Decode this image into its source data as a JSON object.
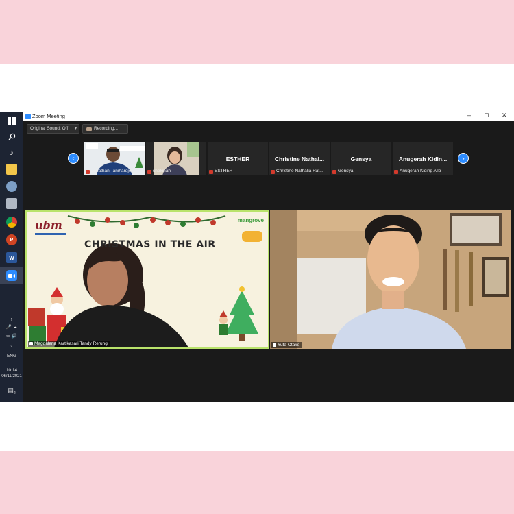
{
  "window": {
    "title": "Zoom Meeting",
    "controls": {
      "minimize": "–",
      "restore": "❐",
      "close": "✕"
    }
  },
  "toolbar": {
    "original_sound": "Original Sound: Off",
    "recording": "Recording..."
  },
  "strip": {
    "prev_icon": "chevron-left-icon",
    "next_icon": "chevron-right-icon",
    "participants": [
      {
        "display": "",
        "label": "Jonathan Tanihardjo",
        "video": true
      },
      {
        "display": "",
        "label": "shekinah",
        "video": true
      },
      {
        "display": "ESTHER",
        "label": "ESTHER",
        "video": false
      },
      {
        "display": "Christine  Nathal...",
        "label": "Christine Nathalia Rat...",
        "video": false
      },
      {
        "display": "Gensya",
        "label": "Gensya",
        "video": false
      },
      {
        "display": "Anugerah  Kidin...",
        "label": "Anugerah Kiding Allo",
        "video": false
      }
    ]
  },
  "main": {
    "left": {
      "name": "Magdalena Kartikasari Tandy Rerung",
      "background_title": "CHRISTMAS IN THE AIR",
      "logo_text": "ubm",
      "logo_right": "mangrove",
      "active_speaker_color": "#b9e36b"
    },
    "right": {
      "name": "Yuta Otake"
    }
  },
  "taskbar": {
    "lang": "ENG",
    "time": "10:14",
    "date": "06/11/2021",
    "notification_count": "2",
    "icons": [
      "windows-icon",
      "search-icon",
      "music-icon",
      "folder-icon",
      "app-icon",
      "app-icon-2",
      "chrome-icon",
      "powerpoint-icon",
      "word-icon",
      "zoom-icon"
    ]
  }
}
